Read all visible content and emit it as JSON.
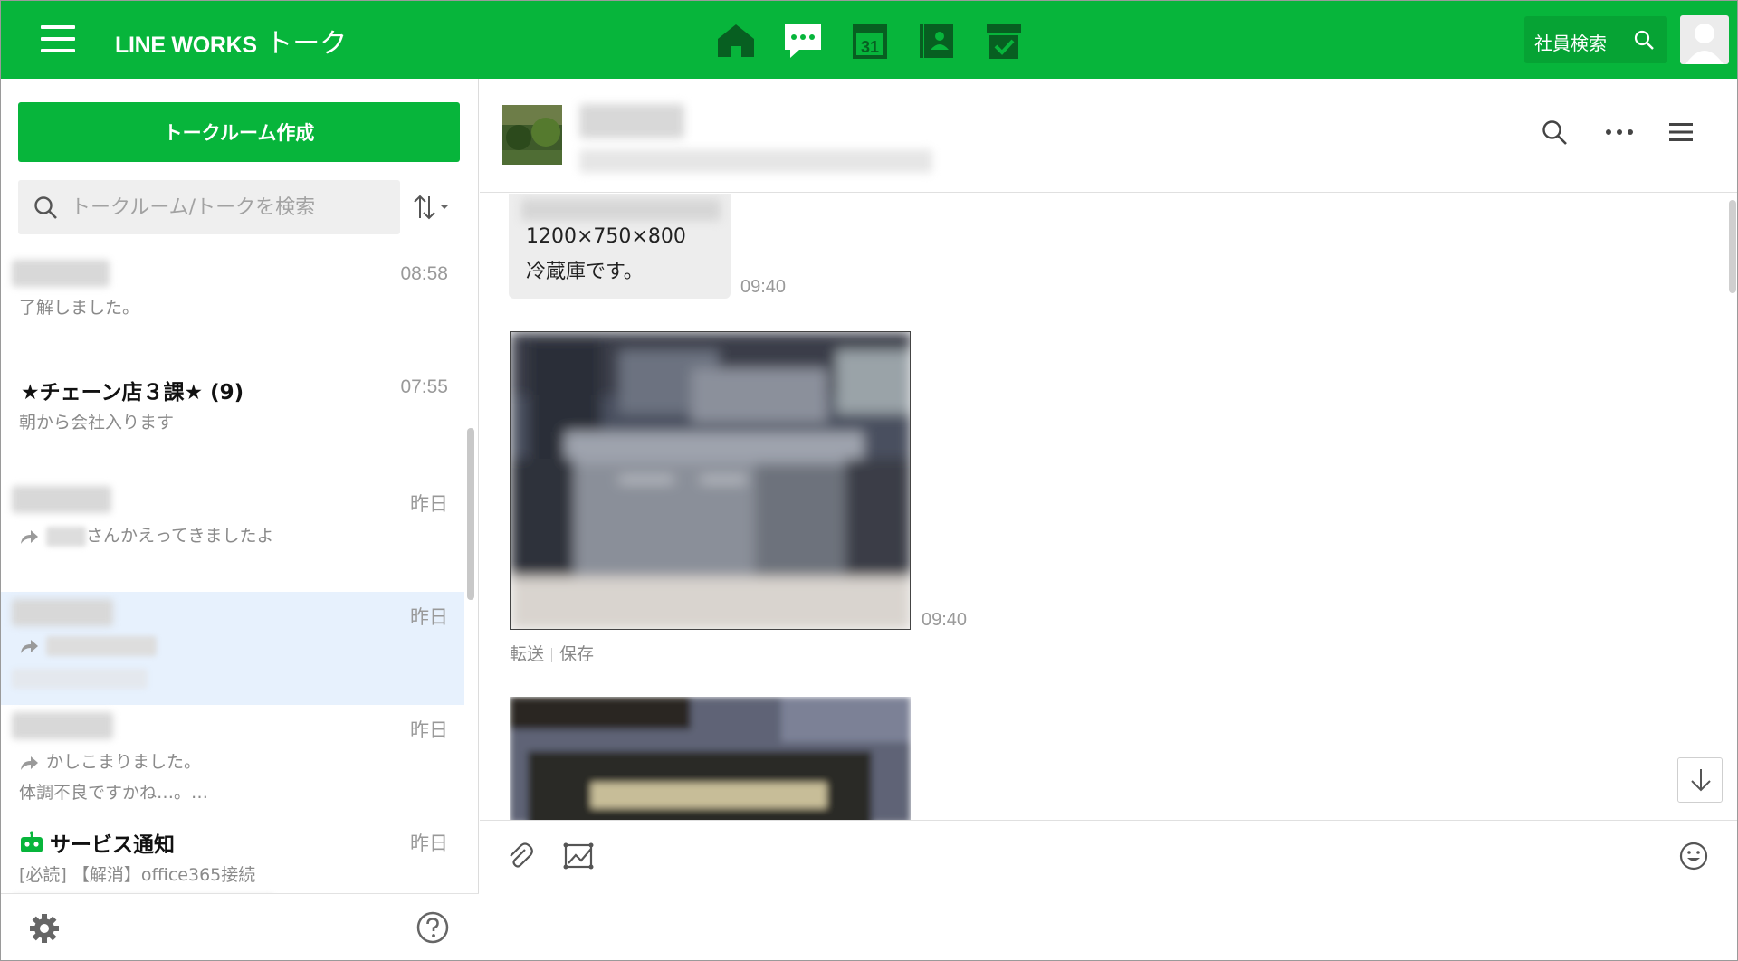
{
  "header": {
    "menu_icon": "hamburger-icon",
    "brand": "LINE WORKS",
    "app_name": "トーク",
    "nav": [
      {
        "name": "home",
        "icon": "home-icon"
      },
      {
        "name": "talk",
        "icon": "chat-icon"
      },
      {
        "name": "calendar",
        "icon": "calendar-icon",
        "label": "31"
      },
      {
        "name": "address",
        "icon": "address-book-icon"
      },
      {
        "name": "task",
        "icon": "task-icon"
      }
    ],
    "employee_search": "社員検索"
  },
  "sidebar": {
    "create_button": "トークルーム作成",
    "search_placeholder": "トークルーム/トークを検索",
    "rooms": [
      {
        "time": "08:58",
        "preview": "了解しました。"
      },
      {
        "name": "★チェーン店３課★ (9)",
        "time": "07:55",
        "preview": "朝から会社入ります"
      },
      {
        "time": "昨日",
        "preview": "さんかえってきましたよ"
      },
      {
        "time": "昨日",
        "selected": true
      },
      {
        "time": "昨日",
        "preview": "かしこまりました。",
        "preview2": "体調不良ですかね…。…"
      },
      {
        "name": "サービス通知",
        "time": "昨日",
        "preview": "[必読] 【解消】office365接続"
      }
    ]
  },
  "room": {
    "messages": [
      {
        "line1": "1200×750×800",
        "line2": "冷蔵庫です。",
        "time": "09:40"
      },
      {
        "type": "photo",
        "time": "09:40",
        "forward": "転送",
        "save": "保存"
      },
      {
        "type": "photo"
      }
    ]
  },
  "colors": {
    "brand_green": "#07b53b",
    "selected_row": "#e7f1fd"
  }
}
